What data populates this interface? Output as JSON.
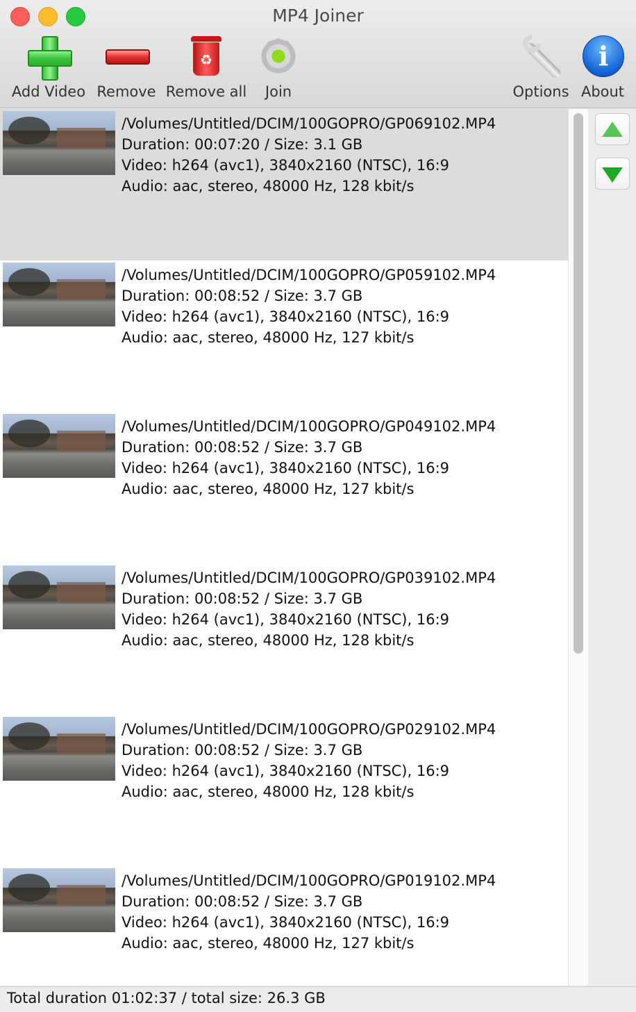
{
  "window": {
    "title": "MP4 Joiner"
  },
  "toolbar": {
    "add_video": "Add Video",
    "remove": "Remove",
    "remove_all": "Remove all",
    "join": "Join",
    "options": "Options",
    "about": "About"
  },
  "files": [
    {
      "path": "/Volumes/Untitled/DCIM/100GOPRO/GP069102.MP4",
      "duration_size": "Duration: 00:07:20 / Size: 3.1 GB",
      "video": "Video: h264 (avc1), 3840x2160 (NTSC), 16:9",
      "audio": "Audio: aac, stereo, 48000 Hz, 128 kbit/s",
      "selected": true
    },
    {
      "path": "/Volumes/Untitled/DCIM/100GOPRO/GP059102.MP4",
      "duration_size": "Duration: 00:08:52 / Size: 3.7 GB",
      "video": "Video: h264 (avc1), 3840x2160 (NTSC), 16:9",
      "audio": "Audio: aac, stereo, 48000 Hz, 127 kbit/s",
      "selected": false
    },
    {
      "path": "/Volumes/Untitled/DCIM/100GOPRO/GP049102.MP4",
      "duration_size": "Duration: 00:08:52 / Size: 3.7 GB",
      "video": "Video: h264 (avc1), 3840x2160 (NTSC), 16:9",
      "audio": "Audio: aac, stereo, 48000 Hz, 127 kbit/s",
      "selected": false
    },
    {
      "path": "/Volumes/Untitled/DCIM/100GOPRO/GP039102.MP4",
      "duration_size": "Duration: 00:08:52 / Size: 3.7 GB",
      "video": "Video: h264 (avc1), 3840x2160 (NTSC), 16:9",
      "audio": "Audio: aac, stereo, 48000 Hz, 128 kbit/s",
      "selected": false
    },
    {
      "path": "/Volumes/Untitled/DCIM/100GOPRO/GP029102.MP4",
      "duration_size": "Duration: 00:08:52 / Size: 3.7 GB",
      "video": "Video: h264 (avc1), 3840x2160 (NTSC), 16:9",
      "audio": "Audio: aac, stereo, 48000 Hz, 128 kbit/s",
      "selected": false
    },
    {
      "path": "/Volumes/Untitled/DCIM/100GOPRO/GP019102.MP4",
      "duration_size": "Duration: 00:08:52 / Size: 3.7 GB",
      "video": "Video: h264 (avc1), 3840x2160 (NTSC), 16:9",
      "audio": "Audio: aac, stereo, 48000 Hz, 127 kbit/s",
      "selected": false
    }
  ],
  "status": {
    "text": "Total duration 01:02:37 / total size: 26.3 GB"
  },
  "colors": {
    "selection": "#dcdcdc",
    "accent_green": "#3cc43c",
    "accent_red": "#e53030",
    "accent_blue": "#1262d6"
  }
}
